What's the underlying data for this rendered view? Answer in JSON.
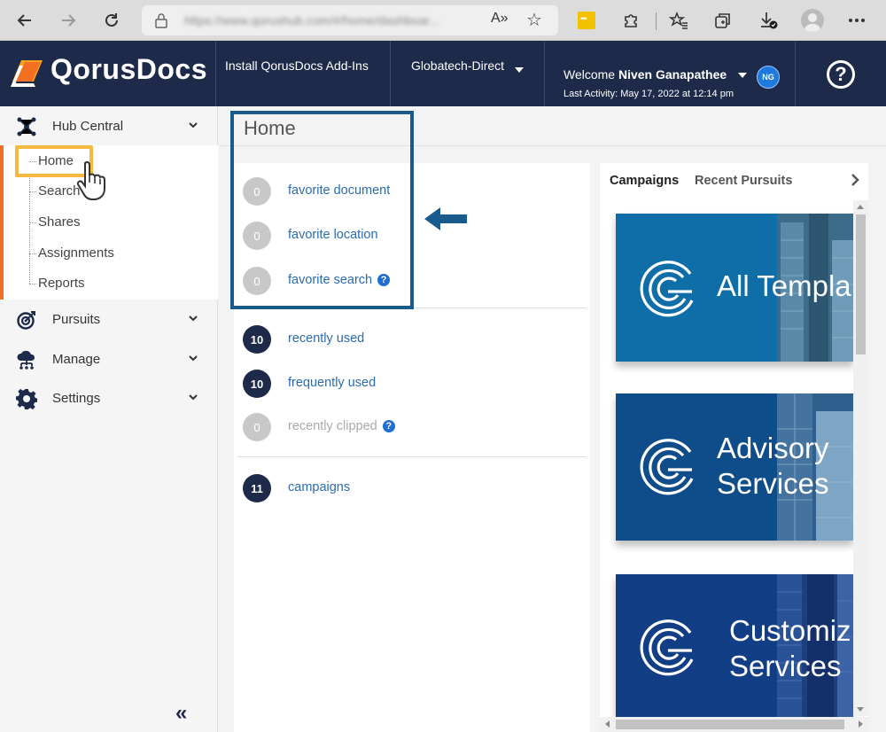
{
  "browser": {
    "url": "https://www.qorushub.com/#/home/dashboar...",
    "read_aloud_label": "A»",
    "icons": [
      "back-icon",
      "forward-icon",
      "refresh-icon",
      "lock-icon",
      "read-aloud-icon",
      "favorite-add-icon",
      "extension-icon",
      "puzzle-icon",
      "favorites-icon",
      "collections-icon",
      "downloads-icon",
      "profile-icon",
      "more-icon"
    ]
  },
  "header": {
    "brand": "QorusDocs",
    "install_label": "Install QorusDocs Add-Ins",
    "tenant": "Globatech-Direct",
    "welcome_prefix": "Welcome",
    "user_name": "Niven Ganapathee",
    "user_initials": "NG",
    "last_activity": "Last Activity: May 17, 2022 at 12:14 pm",
    "help_label": "?"
  },
  "sidebar": {
    "groups": [
      {
        "label": "Hub Central",
        "icon": "hub-network-icon"
      },
      {
        "label": "Pursuits",
        "icon": "target-icon"
      },
      {
        "label": "Manage",
        "icon": "cloud-network-icon"
      },
      {
        "label": "Settings",
        "icon": "gear-icon"
      }
    ],
    "hub_items": [
      "Home",
      "Search",
      "Shares",
      "Assignments",
      "Reports"
    ],
    "collapse_label": "«"
  },
  "main": {
    "title": "Home",
    "favorites": [
      {
        "count": "0",
        "label": "favorite document"
      },
      {
        "count": "0",
        "label": "favorite location"
      },
      {
        "count": "0",
        "label": "favorite search"
      }
    ],
    "activity": [
      {
        "count": "10",
        "label": "recently used"
      },
      {
        "count": "10",
        "label": "frequently used"
      },
      {
        "count": "0",
        "label": "recently clipped"
      }
    ],
    "campaigns": {
      "count": "11",
      "label": "campaigns"
    }
  },
  "right_panel": {
    "tabs": [
      "Campaigns",
      "Recent Pursuits"
    ],
    "cards": [
      {
        "line1": "All Templa",
        "line2": ""
      },
      {
        "line1": "Advisory",
        "line2": "Services"
      },
      {
        "line1": "Customiz",
        "line2": "Services"
      }
    ]
  },
  "colors": {
    "header_bg": "#1d2a4a",
    "accent_orange": "#f36f21",
    "highlight_yellow": "#f4b93e",
    "link_blue": "#2b6cb0",
    "annotation_blue": "#1a5b8e",
    "campaign_blue": "#0f6ea8"
  }
}
